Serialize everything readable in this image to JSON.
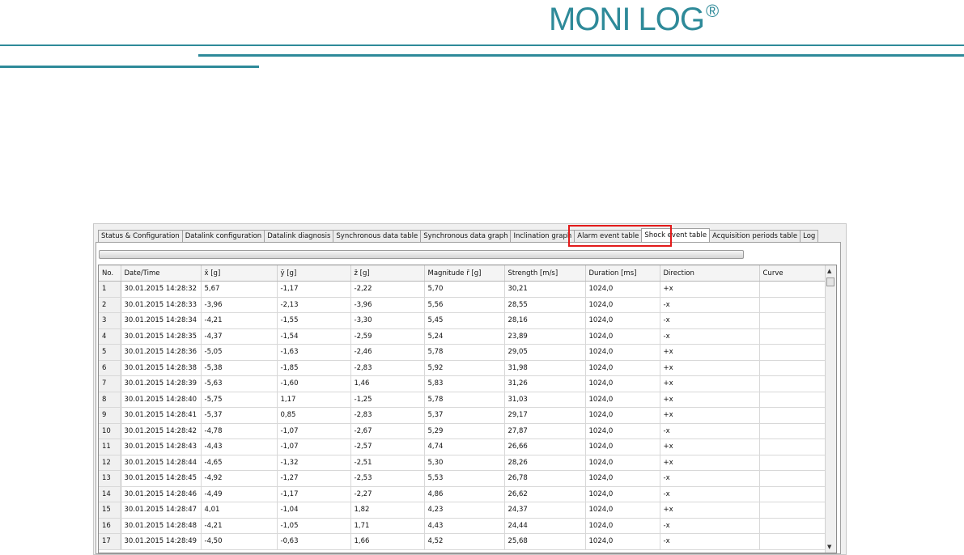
{
  "brand": {
    "name": "MONI LOG",
    "registered": "®"
  },
  "tabs": [
    "Status & Configuration",
    "Datalink configuration",
    "Datalink diagnosis",
    "Synchronous data table",
    "Synchronous data graph",
    "Inclination graph",
    "Alarm event table",
    "Shock event table",
    "Acquisition periods table",
    "Log"
  ],
  "active_tab": "Shock event table",
  "highlight_color": "#e21a1a",
  "accent_color": "#2e8a99",
  "table": {
    "columns": [
      "No.",
      "Date/Time",
      "x̄ [g]",
      "ȳ [g]",
      "z̄ [g]",
      "Magnitude r̄ [g]",
      "Strength [m/s]",
      "Duration [ms]",
      "Direction",
      "Curve"
    ],
    "rows": [
      [
        "1",
        "30.01.2015 14:28:32",
        "5,67",
        "-1,17",
        "-2,22",
        "5,70",
        "30,21",
        "1024,0",
        "+x",
        ""
      ],
      [
        "2",
        "30.01.2015 14:28:33",
        "-3,96",
        "-2,13",
        "-3,96",
        "5,56",
        "28,55",
        "1024,0",
        "-x",
        ""
      ],
      [
        "3",
        "30.01.2015 14:28:34",
        "-4,21",
        "-1,55",
        "-3,30",
        "5,45",
        "28,16",
        "1024,0",
        "-x",
        ""
      ],
      [
        "4",
        "30.01.2015 14:28:35",
        "-4,37",
        "-1,54",
        "-2,59",
        "5,24",
        "23,89",
        "1024,0",
        "-x",
        ""
      ],
      [
        "5",
        "30.01.2015 14:28:36",
        "-5,05",
        "-1,63",
        "-2,46",
        "5,78",
        "29,05",
        "1024,0",
        "+x",
        ""
      ],
      [
        "6",
        "30.01.2015 14:28:38",
        "-5,38",
        "-1,85",
        "-2,83",
        "5,92",
        "31,98",
        "1024,0",
        "+x",
        ""
      ],
      [
        "7",
        "30.01.2015 14:28:39",
        "-5,63",
        "-1,60",
        "1,46",
        "5,83",
        "31,26",
        "1024,0",
        "+x",
        ""
      ],
      [
        "8",
        "30.01.2015 14:28:40",
        "-5,75",
        "1,17",
        "-1,25",
        "5,78",
        "31,03",
        "1024,0",
        "+x",
        ""
      ],
      [
        "9",
        "30.01.2015 14:28:41",
        "-5,37",
        "0,85",
        "-2,83",
        "5,37",
        "29,17",
        "1024,0",
        "+x",
        ""
      ],
      [
        "10",
        "30.01.2015 14:28:42",
        "-4,78",
        "-1,07",
        "-2,67",
        "5,29",
        "27,87",
        "1024,0",
        "-x",
        ""
      ],
      [
        "11",
        "30.01.2015 14:28:43",
        "-4,43",
        "-1,07",
        "-2,57",
        "4,74",
        "26,66",
        "1024,0",
        "+x",
        ""
      ],
      [
        "12",
        "30.01.2015 14:28:44",
        "-4,65",
        "-1,32",
        "-2,51",
        "5,30",
        "28,26",
        "1024,0",
        "+x",
        ""
      ],
      [
        "13",
        "30.01.2015 14:28:45",
        "-4,92",
        "-1,27",
        "-2,53",
        "5,53",
        "26,78",
        "1024,0",
        "-x",
        ""
      ],
      [
        "14",
        "30.01.2015 14:28:46",
        "-4,49",
        "-1,17",
        "-2,27",
        "4,86",
        "26,62",
        "1024,0",
        "-x",
        ""
      ],
      [
        "15",
        "30.01.2015 14:28:47",
        "4,01",
        "-1,04",
        "1,82",
        "4,23",
        "24,37",
        "1024,0",
        "+x",
        ""
      ],
      [
        "16",
        "30.01.2015 14:28:48",
        "-4,21",
        "-1,05",
        "1,71",
        "4,43",
        "24,44",
        "1024,0",
        "-x",
        ""
      ],
      [
        "17",
        "30.01.2015 14:28:49",
        "-4,50",
        "-0,63",
        "1,66",
        "4,52",
        "25,68",
        "1024,0",
        "-x",
        ""
      ]
    ]
  },
  "scrollbar": {
    "up_icon": "▲",
    "down_icon": "▼"
  }
}
